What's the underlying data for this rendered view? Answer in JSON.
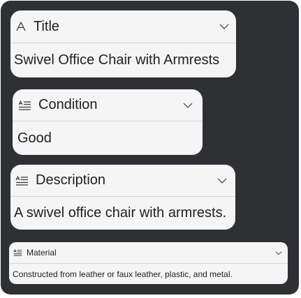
{
  "fields": [
    {
      "label": "Title",
      "value": "Swivel Office Chair with Armrests",
      "icon": "text-font-icon"
    },
    {
      "label": "Condition",
      "value": "Good",
      "icon": "text-lines-icon"
    },
    {
      "label": "Description",
      "value": "A swivel office chair with armrests.",
      "icon": "text-lines-icon"
    },
    {
      "label": "Material",
      "value": "Constructed from leather or faux leather, plastic, and metal.",
      "icon": "text-lines-icon"
    }
  ]
}
